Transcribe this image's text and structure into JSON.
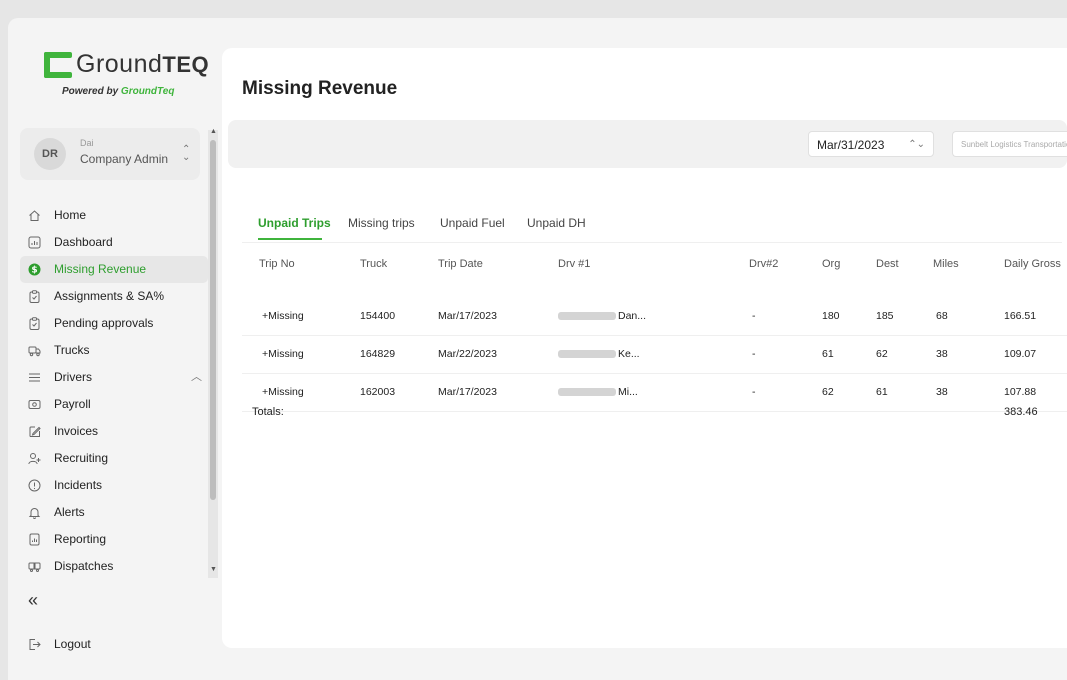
{
  "brand": {
    "logo_word": "Ground",
    "logo_word_bold": "TEQ",
    "powered_prefix": "Powered by",
    "powered_brand": "GroundTeq",
    "accent_color": "#3fb43c"
  },
  "user": {
    "initials": "DR",
    "name": "Dai",
    "role": "Company Admin"
  },
  "sidebar": {
    "items": [
      {
        "label": "Home",
        "icon": "home-icon"
      },
      {
        "label": "Dashboard",
        "icon": "chart-icon"
      },
      {
        "label": "Missing Revenue",
        "icon": "dollar-icon",
        "active": true
      },
      {
        "label": "Assignments & SA%",
        "icon": "clipboard-icon"
      },
      {
        "label": "Pending approvals",
        "icon": "clipboard-check-icon"
      },
      {
        "label": "Trucks",
        "icon": "truck-icon"
      },
      {
        "label": "Drivers",
        "icon": "list-icon"
      },
      {
        "label": "Payroll",
        "icon": "cash-icon"
      },
      {
        "label": "Invoices",
        "icon": "edit-icon"
      },
      {
        "label": "Recruiting",
        "icon": "user-plus-icon"
      },
      {
        "label": "Incidents",
        "icon": "alert-circle-icon"
      },
      {
        "label": "Alerts",
        "icon": "bell-icon"
      },
      {
        "label": "Reporting",
        "icon": "report-icon"
      },
      {
        "label": "Dispatches",
        "icon": "dispatch-icon"
      }
    ],
    "collapse_glyph": "«",
    "logout_label": "Logout"
  },
  "main": {
    "title": "Missing Revenue",
    "date_value": "Mar/31/2023",
    "search_text": "Sunbelt Logistics Transportation"
  },
  "tabs": [
    {
      "label": "Unpaid Trips",
      "active": true
    },
    {
      "label": "Missing trips"
    },
    {
      "label": "Unpaid Fuel"
    },
    {
      "label": "Unpaid DH"
    }
  ],
  "table": {
    "headers": [
      "Trip No",
      "Truck",
      "Trip Date",
      "Drv #1",
      "Drv#2",
      "Org",
      "Dest",
      "Miles",
      "Daily Gross"
    ],
    "rows": [
      {
        "trip_no": "+Missing",
        "truck": "154400",
        "trip_date": "Mar/17/2023",
        "drv1_suffix": "Dan...",
        "drv2": "-",
        "org": "180",
        "dest": "185",
        "miles": "68",
        "gross": "166.51"
      },
      {
        "trip_no": "+Missing",
        "truck": "164829",
        "trip_date": "Mar/22/2023",
        "drv1_suffix": "Ke...",
        "drv2": "-",
        "org": "61",
        "dest": "62",
        "miles": "38",
        "gross": "109.07"
      },
      {
        "trip_no": "+Missing",
        "truck": "162003",
        "trip_date": "Mar/17/2023",
        "drv1_suffix": "Mi...",
        "drv2": "-",
        "org": "62",
        "dest": "61",
        "miles": "38",
        "gross": "107.88"
      }
    ],
    "totals_label": "Totals:",
    "totals_value": "383.46"
  }
}
